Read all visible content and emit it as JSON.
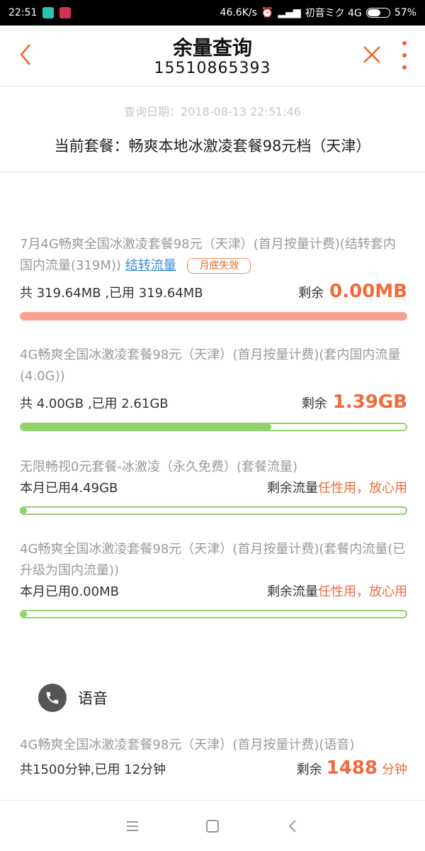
{
  "status_bar": {
    "time": "22:51",
    "speed": "46.6K/s",
    "carrier": "初音ミク 4G",
    "battery": "57%",
    "battery_level": 0.57
  },
  "header": {
    "title": "余量查询",
    "phone": "15510865393"
  },
  "query_date": "查询日期：2018-08-13 22:51:46",
  "plan": "当前套餐：畅爽本地冰激凌套餐98元档（天津）",
  "packages": [
    {
      "desc": "7月4G畅爽全国冰激凌套餐98元（天津）(首月按量计费)(结转套内国内流量(319M))",
      "link": "结转流量",
      "badge": "月底失效",
      "total_used": "共 319.64MB ,已用 319.64MB",
      "remain_label": "剩余",
      "remain_value": "0.00MB",
      "used_fraction": 1.0,
      "color": "#f6a08f"
    },
    {
      "desc": "4G畅爽全国冰激凌套餐98元（天津）(首月按量计费)(套内国内流量(4.0G))",
      "total_used": "共 4.00GB ,已用 2.61GB",
      "remain_label": "剩余",
      "remain_value": "1.39GB",
      "used_fraction": 0.65,
      "color": "#8fd16b"
    },
    {
      "desc": "无限畅视0元套餐-冰激凌（永久免费）(套餐流量)",
      "total_used": "本月已用4.49GB",
      "remain_label": "剩余流量",
      "remain_value": "任性用，放心用",
      "used_fraction": 0.01,
      "color": "#8fd16b"
    },
    {
      "desc": "4G畅爽全国冰激凌套餐98元（天津）(首月按量计费)(套餐内流量(已升级为国内流量))",
      "total_used": "本月已用0.00MB",
      "remain_label": "剩余流量",
      "remain_value": "任性用，放心用",
      "used_fraction": 0.01,
      "color": "#8fd16b"
    }
  ],
  "voice": {
    "title": "语音",
    "desc": "4G畅爽全国冰激凌套餐98元（天津）(首月按量计费)(语音)",
    "total_used": "共1500分钟,已用 12分钟",
    "remain_label": "剩余",
    "remain_value": "1488",
    "remain_unit": "分钟"
  },
  "icons": {
    "back": "back-arrow-icon",
    "close": "close-icon",
    "more": "more-vertical-icon",
    "phone": "phone-icon",
    "nav_menu": "menu-icon",
    "nav_home": "home-square-icon",
    "nav_back": "back-chevron-icon"
  }
}
